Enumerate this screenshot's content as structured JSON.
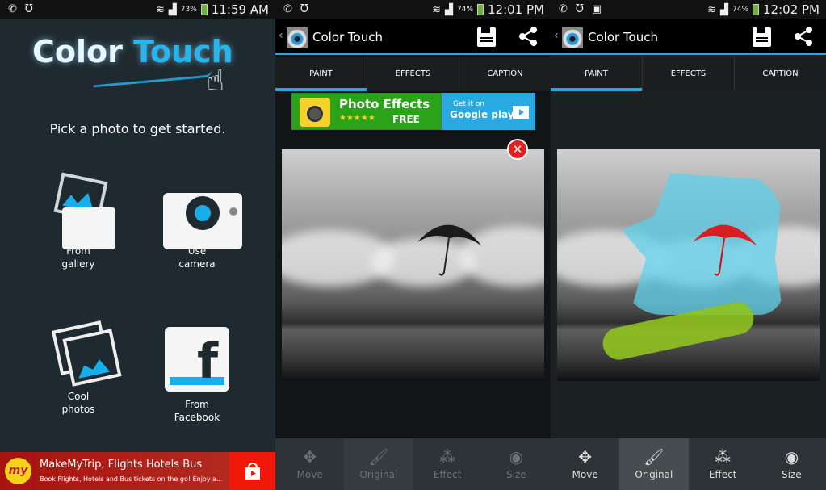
{
  "screens": [
    {
      "status": {
        "battery": "73%",
        "time": "11:59 AM"
      },
      "title_part1": "Color ",
      "title_part2": "Touch",
      "subtitle": "Pick a photo to get started.",
      "options": [
        {
          "line1": "From",
          "line2": "gallery"
        },
        {
          "line1": "Use",
          "line2": "camera"
        },
        {
          "line1": "Cool",
          "line2": "photos"
        },
        {
          "line1": "From",
          "line2": "Facebook"
        }
      ],
      "ad": {
        "logo": "my",
        "title": "MakeMyTrip, Flights Hotels Bus",
        "text": "Book Flights, Hotels and Bus tickets on the go! Enjoy a..."
      }
    },
    {
      "status": {
        "battery": "74%",
        "time": "12:01 PM"
      },
      "app_title": "Color Touch",
      "tabs": [
        "PAINT",
        "EFFECTS",
        "CAPTION"
      ],
      "promo": {
        "title": "Photo Effects",
        "stars": "★★★★★",
        "free": "FREE",
        "get": "Get it on",
        "store": "Google play"
      },
      "tools": [
        "Move",
        "Original",
        "Effect",
        "Size"
      ]
    },
    {
      "status": {
        "battery": "74%",
        "time": "12:02 PM"
      },
      "app_title": "Color Touch",
      "tabs": [
        "PAINT",
        "EFFECTS",
        "CAPTION"
      ],
      "tools": [
        "Move",
        "Original",
        "Effect",
        "Size"
      ],
      "selected_tool": "Original"
    }
  ],
  "colors": {
    "accent": "#2aa6dc",
    "umbrella_colored": "#d81e22",
    "paint_cyan": "#5fd0ea",
    "paint_green": "#8fc31f"
  }
}
